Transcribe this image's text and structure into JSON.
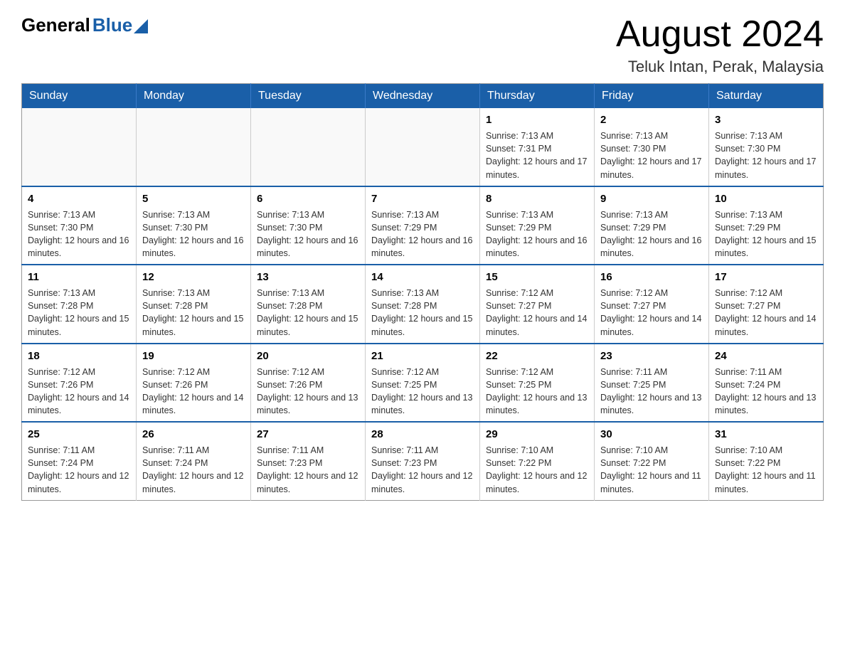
{
  "header": {
    "logo": {
      "general_text": "General",
      "blue_text": "Blue"
    },
    "title": "August 2024",
    "location": "Teluk Intan, Perak, Malaysia"
  },
  "calendar": {
    "days_of_week": [
      "Sunday",
      "Monday",
      "Tuesday",
      "Wednesday",
      "Thursday",
      "Friday",
      "Saturday"
    ],
    "weeks": [
      [
        {
          "day": "",
          "info": ""
        },
        {
          "day": "",
          "info": ""
        },
        {
          "day": "",
          "info": ""
        },
        {
          "day": "",
          "info": ""
        },
        {
          "day": "1",
          "info": "Sunrise: 7:13 AM\nSunset: 7:31 PM\nDaylight: 12 hours and 17 minutes."
        },
        {
          "day": "2",
          "info": "Sunrise: 7:13 AM\nSunset: 7:30 PM\nDaylight: 12 hours and 17 minutes."
        },
        {
          "day": "3",
          "info": "Sunrise: 7:13 AM\nSunset: 7:30 PM\nDaylight: 12 hours and 17 minutes."
        }
      ],
      [
        {
          "day": "4",
          "info": "Sunrise: 7:13 AM\nSunset: 7:30 PM\nDaylight: 12 hours and 16 minutes."
        },
        {
          "day": "5",
          "info": "Sunrise: 7:13 AM\nSunset: 7:30 PM\nDaylight: 12 hours and 16 minutes."
        },
        {
          "day": "6",
          "info": "Sunrise: 7:13 AM\nSunset: 7:30 PM\nDaylight: 12 hours and 16 minutes."
        },
        {
          "day": "7",
          "info": "Sunrise: 7:13 AM\nSunset: 7:29 PM\nDaylight: 12 hours and 16 minutes."
        },
        {
          "day": "8",
          "info": "Sunrise: 7:13 AM\nSunset: 7:29 PM\nDaylight: 12 hours and 16 minutes."
        },
        {
          "day": "9",
          "info": "Sunrise: 7:13 AM\nSunset: 7:29 PM\nDaylight: 12 hours and 16 minutes."
        },
        {
          "day": "10",
          "info": "Sunrise: 7:13 AM\nSunset: 7:29 PM\nDaylight: 12 hours and 15 minutes."
        }
      ],
      [
        {
          "day": "11",
          "info": "Sunrise: 7:13 AM\nSunset: 7:28 PM\nDaylight: 12 hours and 15 minutes."
        },
        {
          "day": "12",
          "info": "Sunrise: 7:13 AM\nSunset: 7:28 PM\nDaylight: 12 hours and 15 minutes."
        },
        {
          "day": "13",
          "info": "Sunrise: 7:13 AM\nSunset: 7:28 PM\nDaylight: 12 hours and 15 minutes."
        },
        {
          "day": "14",
          "info": "Sunrise: 7:13 AM\nSunset: 7:28 PM\nDaylight: 12 hours and 15 minutes."
        },
        {
          "day": "15",
          "info": "Sunrise: 7:12 AM\nSunset: 7:27 PM\nDaylight: 12 hours and 14 minutes."
        },
        {
          "day": "16",
          "info": "Sunrise: 7:12 AM\nSunset: 7:27 PM\nDaylight: 12 hours and 14 minutes."
        },
        {
          "day": "17",
          "info": "Sunrise: 7:12 AM\nSunset: 7:27 PM\nDaylight: 12 hours and 14 minutes."
        }
      ],
      [
        {
          "day": "18",
          "info": "Sunrise: 7:12 AM\nSunset: 7:26 PM\nDaylight: 12 hours and 14 minutes."
        },
        {
          "day": "19",
          "info": "Sunrise: 7:12 AM\nSunset: 7:26 PM\nDaylight: 12 hours and 14 minutes."
        },
        {
          "day": "20",
          "info": "Sunrise: 7:12 AM\nSunset: 7:26 PM\nDaylight: 12 hours and 13 minutes."
        },
        {
          "day": "21",
          "info": "Sunrise: 7:12 AM\nSunset: 7:25 PM\nDaylight: 12 hours and 13 minutes."
        },
        {
          "day": "22",
          "info": "Sunrise: 7:12 AM\nSunset: 7:25 PM\nDaylight: 12 hours and 13 minutes."
        },
        {
          "day": "23",
          "info": "Sunrise: 7:11 AM\nSunset: 7:25 PM\nDaylight: 12 hours and 13 minutes."
        },
        {
          "day": "24",
          "info": "Sunrise: 7:11 AM\nSunset: 7:24 PM\nDaylight: 12 hours and 13 minutes."
        }
      ],
      [
        {
          "day": "25",
          "info": "Sunrise: 7:11 AM\nSunset: 7:24 PM\nDaylight: 12 hours and 12 minutes."
        },
        {
          "day": "26",
          "info": "Sunrise: 7:11 AM\nSunset: 7:24 PM\nDaylight: 12 hours and 12 minutes."
        },
        {
          "day": "27",
          "info": "Sunrise: 7:11 AM\nSunset: 7:23 PM\nDaylight: 12 hours and 12 minutes."
        },
        {
          "day": "28",
          "info": "Sunrise: 7:11 AM\nSunset: 7:23 PM\nDaylight: 12 hours and 12 minutes."
        },
        {
          "day": "29",
          "info": "Sunrise: 7:10 AM\nSunset: 7:22 PM\nDaylight: 12 hours and 12 minutes."
        },
        {
          "day": "30",
          "info": "Sunrise: 7:10 AM\nSunset: 7:22 PM\nDaylight: 12 hours and 11 minutes."
        },
        {
          "day": "31",
          "info": "Sunrise: 7:10 AM\nSunset: 7:22 PM\nDaylight: 12 hours and 11 minutes."
        }
      ]
    ]
  }
}
